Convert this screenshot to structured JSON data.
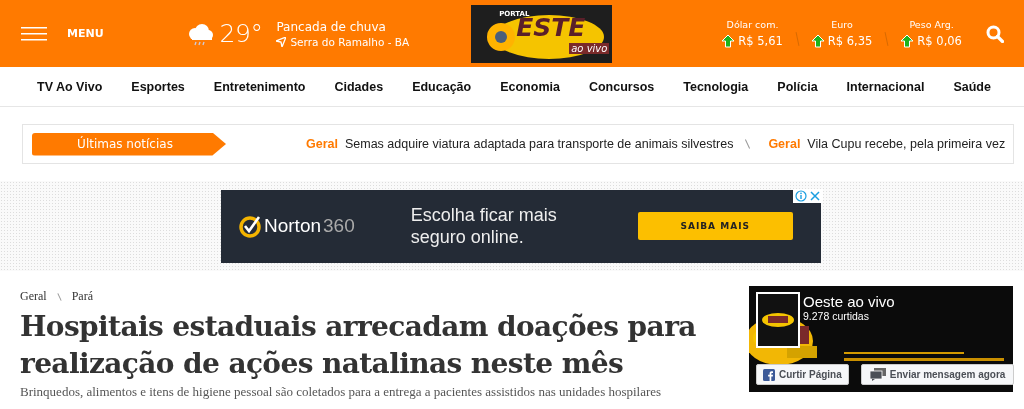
{
  "header": {
    "menu_label": "MENU",
    "weather": {
      "temperature": "29°",
      "condition": "Pancada de chuva",
      "location": "Serra do Ramalho - BA"
    },
    "logo": {
      "top": "PORTAL",
      "main": "ESTE",
      "bottom": "ao vivo"
    },
    "currencies": [
      {
        "name": "Dólar com.",
        "value": "R$ 5,61",
        "rising": true
      },
      {
        "name": "Euro",
        "value": "R$ 6,35",
        "rising": true
      },
      {
        "name": "Peso Arg.",
        "value": "R$ 0,06",
        "rising": true
      }
    ]
  },
  "nav": {
    "items": [
      "TV Ao Vivo",
      "Esportes",
      "Entretenimento",
      "Cidades",
      "Educação",
      "Economia",
      "Concursos",
      "Tecnologia",
      "Polícia",
      "Internacional",
      "Saúde"
    ]
  },
  "ticker": {
    "label": "Últimas notícias",
    "items": [
      {
        "category": "Geral",
        "headline": "Semas adquire viatura adaptada para transporte de animais silvestres"
      },
      {
        "category": "Geral",
        "headline": "Vila Cupu recebe, pela primeira vez"
      }
    ]
  },
  "ad": {
    "brand": "Norton",
    "brand_suffix": "360",
    "text": "Escolha ficar mais seguro online.",
    "button": "SAIBA MAIS"
  },
  "article": {
    "breadcrumb": [
      "Geral",
      "Pará"
    ],
    "title": "Hospitais estaduais arrecadam doações para realização de ações natalinas neste mês",
    "subtitle": "Brinquedos, alimentos e itens de higiene pessoal são coletados para a entrega a pacientes assistidos nas unidades hospilares"
  },
  "facebook_widget": {
    "page_name": "Oeste ao vivo",
    "likes": "9.278 curtidas",
    "like_button": "Curtir Página",
    "message_button": "Enviar mensagem agora"
  }
}
